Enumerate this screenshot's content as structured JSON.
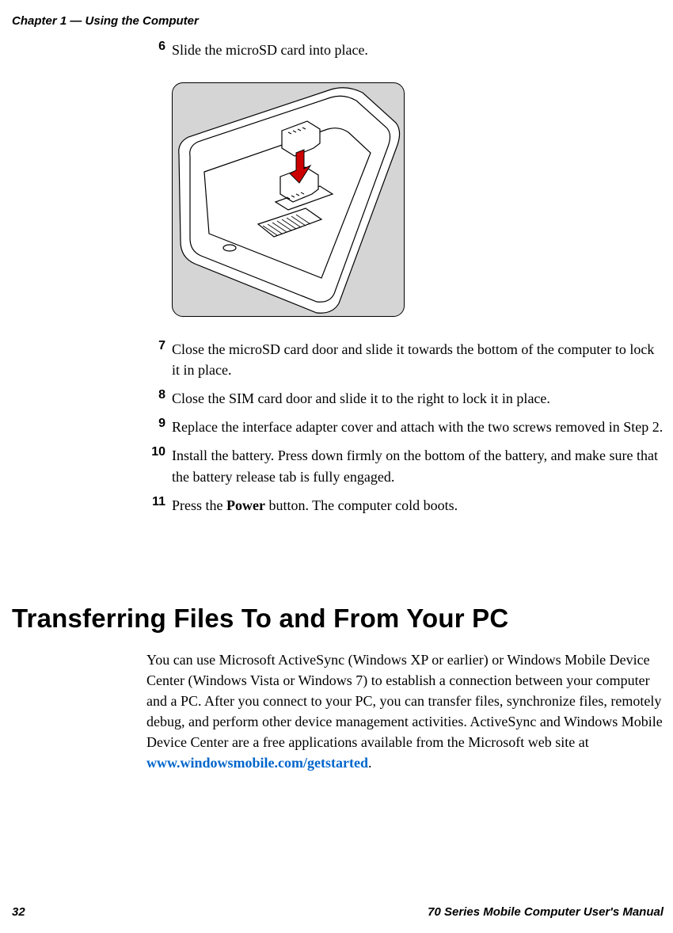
{
  "header": {
    "chapter": "Chapter 1 — Using the Computer"
  },
  "steps": {
    "s6": {
      "num": "6",
      "text": "Slide the microSD card into place."
    },
    "s7": {
      "num": "7",
      "text": "Close the microSD card door and slide it towards the bottom of the computer to lock it in place."
    },
    "s8": {
      "num": "8",
      "text": "Close the SIM card door and slide it to the right to lock it in place."
    },
    "s9": {
      "num": "9",
      "text": "Replace the interface adapter cover and attach with the two screws removed in Step 2."
    },
    "s10": {
      "num": "10",
      "text": "Install the battery. Press down firmly on the bottom of the battery, and make sure that the battery release tab is fully engaged."
    },
    "s11": {
      "num": "11",
      "prefix": "Press the ",
      "bold": "Power",
      "suffix": " button. The computer cold boots."
    }
  },
  "section": {
    "title": "Transferring Files To and From Your PC",
    "para_pre": "You can use Microsoft ActiveSync (Windows XP or earlier) or Windows Mobile Device Center (Windows Vista or Windows 7) to establish a connection between your computer and a PC. After you connect to your PC, you can transfer files, synchronize files, remotely debug, and perform other device management activities. ActiveSync and Windows Mobile Device Center are a free applications available from the Microsoft web site at ",
    "para_link": "www.windowsmobile.com/getstarted",
    "para_post": "."
  },
  "footer": {
    "page": "32",
    "manual": "70 Series Mobile Computer User's Manual"
  }
}
